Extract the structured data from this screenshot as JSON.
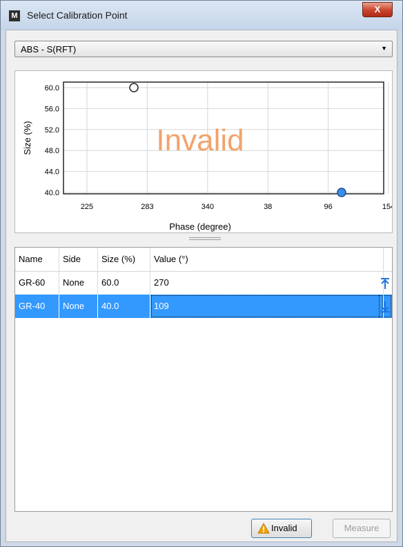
{
  "window": {
    "title": "Select Calibration Point",
    "app_icon_letter": "M",
    "close_glyph": "X"
  },
  "combo": {
    "selected": "ABS - S(RFT)"
  },
  "chart_data": {
    "type": "scatter",
    "xlabel": "Phase (degree)",
    "ylabel": "Size (%)",
    "x_tick_labels": [
      "225",
      "283",
      "340",
      "38",
      "96",
      "154"
    ],
    "y_tick_labels": [
      "60.0",
      "56.0",
      "52.0",
      "48.0",
      "44.0",
      "40.0"
    ],
    "ylim": [
      40,
      60
    ],
    "grid": true,
    "watermark": "Invalid",
    "points": [
      {
        "label": "GR-60",
        "phase": 270,
        "size": 60.0,
        "filled": false
      },
      {
        "label": "GR-40",
        "phase": 109,
        "size": 40.0,
        "filled": true
      }
    ]
  },
  "table": {
    "columns": [
      "Name",
      "Side",
      "Size (%)",
      "Value (°)"
    ],
    "rows": [
      {
        "name": "GR-60",
        "side": "None",
        "size": "60.0",
        "value": "270",
        "icon": "arrow-up-to-line-icon",
        "selected": false
      },
      {
        "name": "GR-40",
        "side": "None",
        "size": "40.0",
        "value": "109",
        "icon": "arrow-down-to-line-icon",
        "selected": true
      }
    ]
  },
  "buttons": {
    "invalid_label": "Invalid",
    "measure_label": "Measure"
  },
  "colors": {
    "selection": "#3399ff",
    "watermark": "#f2a36b",
    "arrow": "#1e73d8",
    "warning": "#f0a30a"
  }
}
